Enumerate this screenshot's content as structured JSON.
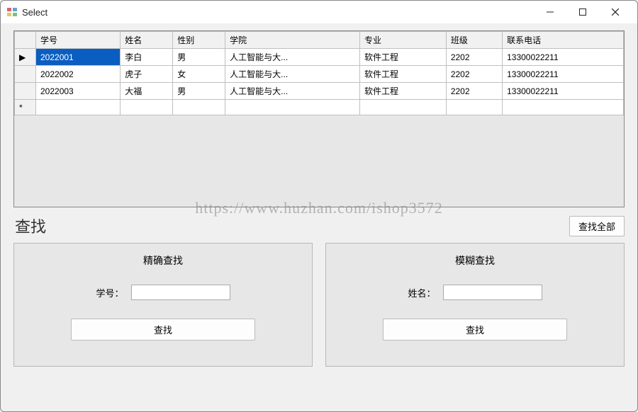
{
  "window": {
    "title": "Select"
  },
  "grid": {
    "headers": [
      "学号",
      "姓名",
      "性别",
      "学院",
      "专业",
      "班级",
      "联系电话"
    ],
    "rows": [
      {
        "indicator": "▶",
        "cells": [
          "2022001",
          "李白",
          "男",
          "人工智能与大...",
          "软件工程",
          "2202",
          "13300022211"
        ],
        "selected_cell_index": 0
      },
      {
        "indicator": "",
        "cells": [
          "2022002",
          "虎子",
          "女",
          "人工智能与大...",
          "软件工程",
          "2202",
          "13300022211"
        ]
      },
      {
        "indicator": "",
        "cells": [
          "2022003",
          "大福",
          "男",
          "人工智能与大...",
          "软件工程",
          "2202",
          "13300022211"
        ]
      },
      {
        "indicator": "*",
        "cells": [
          "",
          "",
          "",
          "",
          "",
          "",
          ""
        ]
      }
    ]
  },
  "watermark": "https://www.huzhan.com/ishop3572",
  "section": {
    "title": "查找",
    "search_all": "查找全部"
  },
  "exact": {
    "title": "精确查找",
    "label": "学号：",
    "value": "",
    "button": "查找"
  },
  "fuzzy": {
    "title": "模糊查找",
    "label": "姓名：",
    "value": "",
    "button": "查找"
  }
}
